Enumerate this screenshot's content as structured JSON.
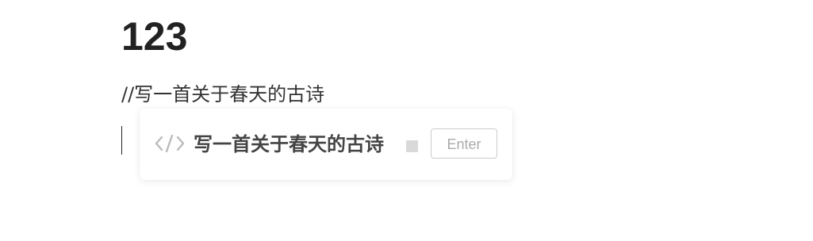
{
  "document": {
    "title": "123",
    "prompt_line": "//写一首关于春天的古诗"
  },
  "suggestion_popup": {
    "icon": "code-icon",
    "text": "写一首关于春天的古诗",
    "stop_icon": "stop-square-icon",
    "enter_label": "Enter"
  },
  "colors": {
    "title": "#222222",
    "text": "#333333",
    "suggestion_text": "#444444",
    "muted": "#aaaaaa",
    "border": "#cccccc"
  }
}
